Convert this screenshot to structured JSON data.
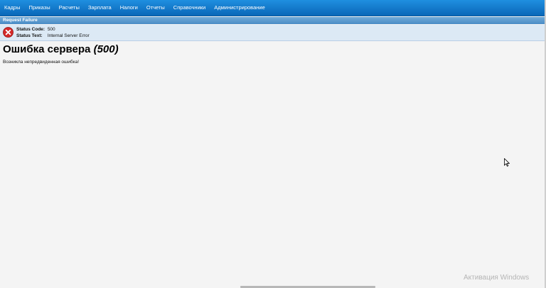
{
  "nav": {
    "items": [
      "Кадры",
      "Приказы",
      "Расчеты",
      "Зарплата",
      "Налоги",
      "Отчеты",
      "Справочники",
      "Администрирование"
    ]
  },
  "request_bar": {
    "title": "Request Failure"
  },
  "status": {
    "code_label": "Status Code:",
    "code_value": "500",
    "text_label": "Status Text:",
    "text_value": "Internal Server Error",
    "icon": "error-x-icon"
  },
  "page": {
    "title": "Ошибка сервера",
    "title_code": "(500)",
    "message": "Возникла непредвиденная ошибка!"
  },
  "watermark": {
    "text": "Активация Windows"
  },
  "colors": {
    "nav_bg": "#0a67b8",
    "req_bar_bg": "#4a8cc6",
    "status_bg": "#dce9f5",
    "error_red": "#d42a2a",
    "page_bg": "#f4f4f4"
  }
}
